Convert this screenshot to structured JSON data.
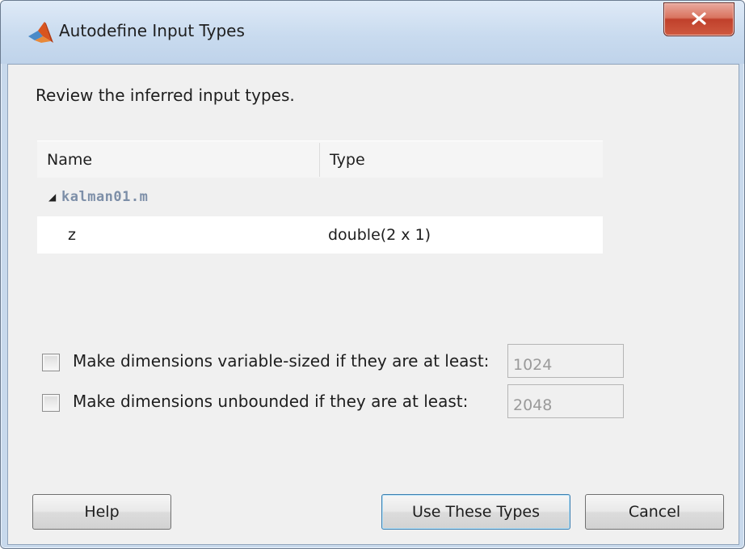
{
  "window": {
    "title": "Autodefine Input Types",
    "icon": "matlab-logo-icon",
    "close_icon": "close-icon"
  },
  "instruction": "Review the inferred input types.",
  "table": {
    "columns": [
      "Name",
      "Type"
    ],
    "group": {
      "expand_icon": "expanded-triangle-icon",
      "label": "kalman01.m"
    },
    "rows": [
      {
        "name": "z",
        "type": "double(2 x 1)"
      }
    ]
  },
  "options": [
    {
      "label": "Make dimensions variable-sized if they are at least:",
      "value": "1024",
      "checked": false
    },
    {
      "label": "Make dimensions unbounded if they are at least:",
      "value": "2048",
      "checked": false
    }
  ],
  "buttons": {
    "help": "Help",
    "use_types": "Use These Types",
    "cancel": "Cancel"
  }
}
